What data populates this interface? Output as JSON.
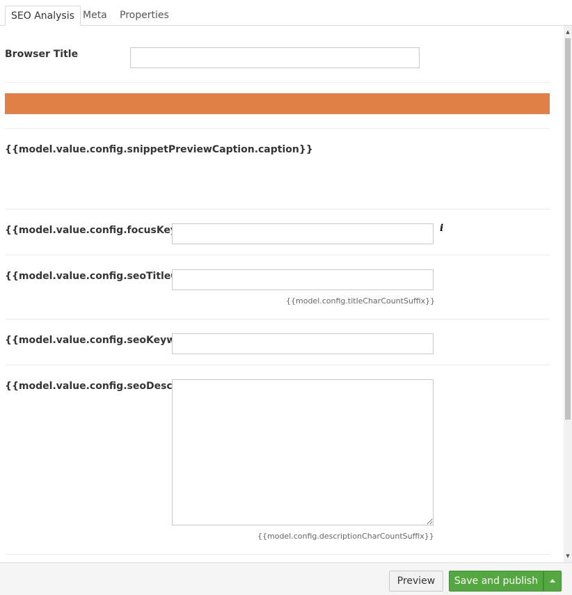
{
  "tabs": [
    {
      "label": "SEO Analysis",
      "active": true
    },
    {
      "label": "Meta",
      "active": false
    },
    {
      "label": "Properties",
      "active": false
    }
  ],
  "form": {
    "browser_title_label": "Browser Title",
    "browser_title_value": "",
    "snippet_caption": "{{model.value.config.snippetPreviewCaption.caption}}",
    "focus_keyword_label": "{{model.value.config.focusKeywordCaption}}",
    "focus_keyword_value": "",
    "seo_title_label": "{{model.value.config.seoTitleCaption}}",
    "seo_title_value": "",
    "title_char_count_hint": "{{model.config.titleCharCountSuffix}}",
    "seo_keywords_label": "{{model.value.config.seoKeywordsCaption}}",
    "seo_keywords_value": "",
    "seo_description_label": "{{model.value.config.seoDescriptionCaption}}",
    "seo_description_value": "",
    "description_char_count_hint": "{{model.config.descriptionCharCountSuffix}}"
  },
  "icons": {
    "info": "i"
  },
  "footer": {
    "preview_label": "Preview",
    "publish_label": "Save and publish"
  },
  "colors": {
    "score_bar": "#e08046",
    "publish_button": "#53a93f"
  }
}
